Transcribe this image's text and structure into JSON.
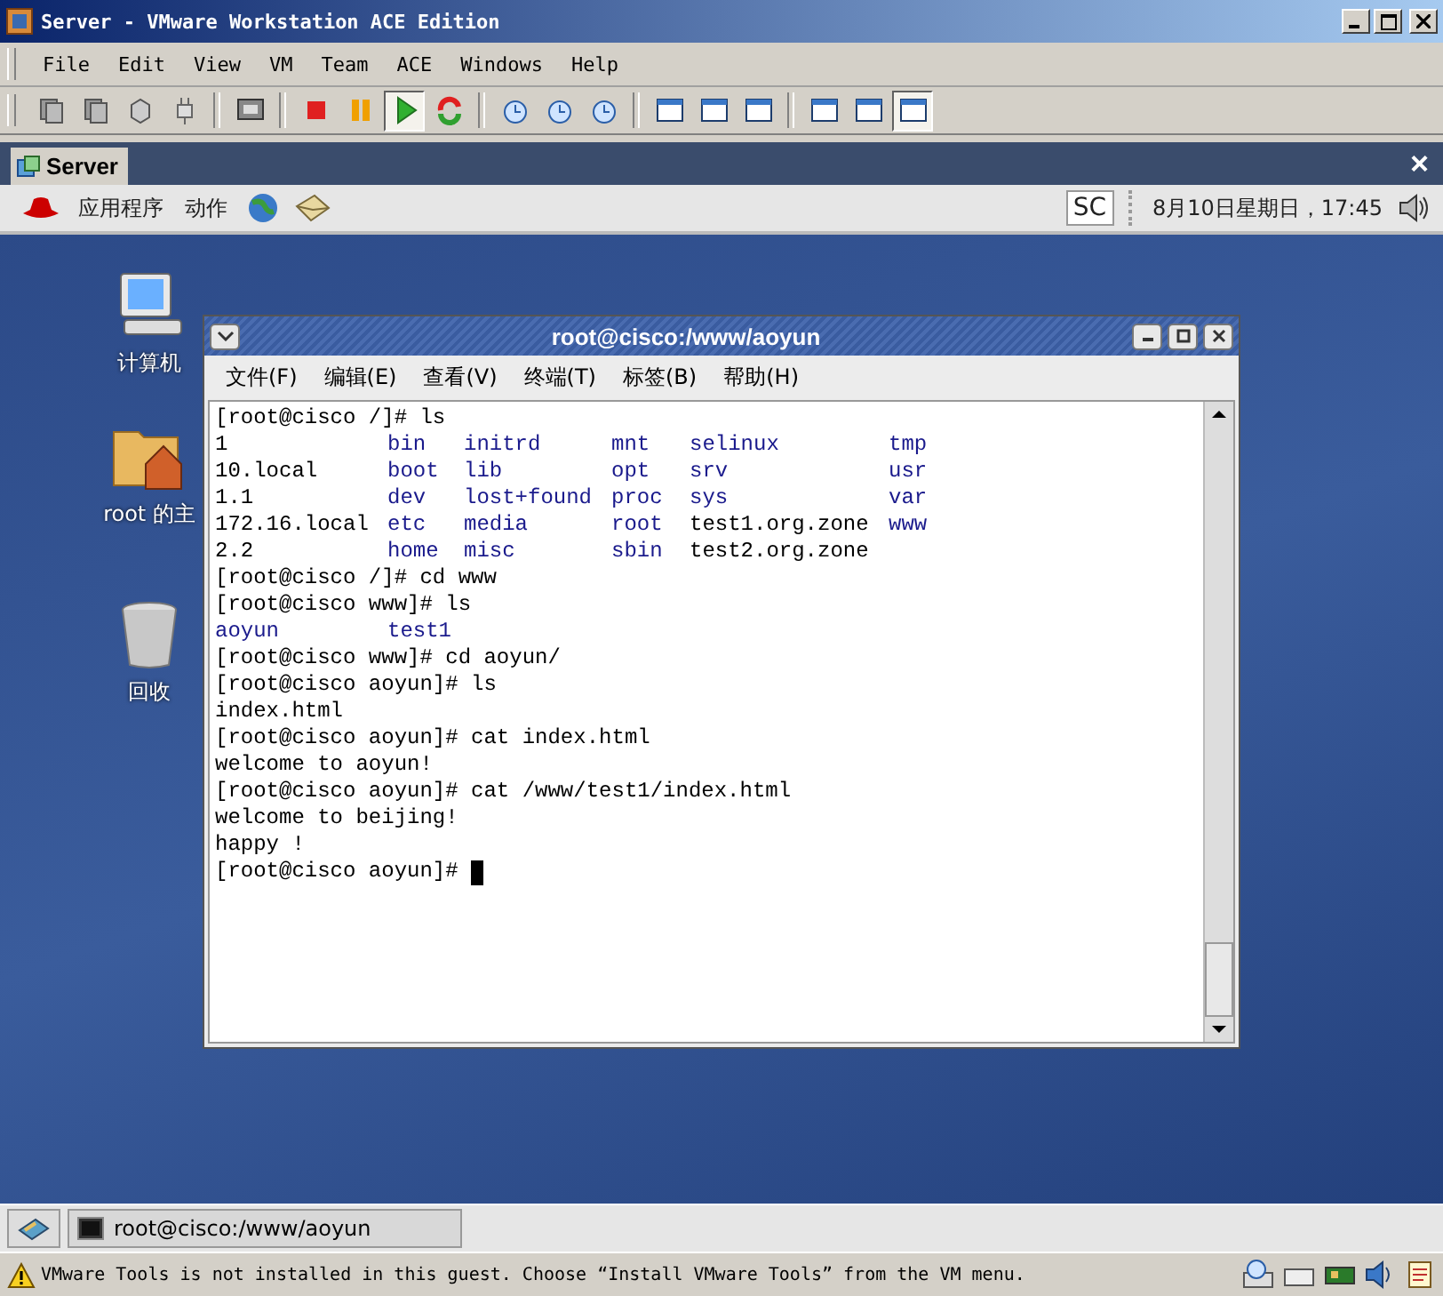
{
  "window": {
    "title": "Server - VMware Workstation ACE Edition"
  },
  "menu": [
    "File",
    "Edit",
    "View",
    "VM",
    "Team",
    "ACE",
    "Windows",
    "Help"
  ],
  "toolbar": [
    [
      {
        "kind": "snap",
        "pressed": false
      },
      {
        "kind": "snap",
        "pressed": false
      },
      {
        "kind": "cube",
        "pressed": false
      },
      {
        "kind": "plug",
        "pressed": false
      }
    ],
    [
      {
        "kind": "screen",
        "pressed": false
      }
    ],
    [
      {
        "kind": "stop",
        "pressed": false
      },
      {
        "kind": "pause",
        "pressed": false
      },
      {
        "kind": "play",
        "pressed": true
      },
      {
        "kind": "reset",
        "pressed": false
      }
    ],
    [
      {
        "kind": "clock",
        "pressed": false
      },
      {
        "kind": "clock",
        "pressed": false
      },
      {
        "kind": "clock",
        "pressed": false
      }
    ],
    [
      {
        "kind": "win",
        "pressed": false
      },
      {
        "kind": "win",
        "pressed": false
      },
      {
        "kind": "win",
        "pressed": false
      }
    ],
    [
      {
        "kind": "win",
        "pressed": false
      },
      {
        "kind": "win",
        "pressed": false
      },
      {
        "kind": "win",
        "pressed": true
      }
    ]
  ],
  "tabs": [
    {
      "label": "Server",
      "selected": true
    }
  ],
  "tab_close": "×",
  "panel": {
    "menus": [
      "应用程序",
      "动作"
    ],
    "input_method": "SC",
    "clock": "8月10日星期日，17:45"
  },
  "desktop_icons": [
    {
      "kind": "computer",
      "label": "计算机"
    },
    {
      "kind": "home",
      "label": "root 的主"
    },
    {
      "kind": "trash",
      "label": "回收"
    }
  ],
  "terminal": {
    "title": "root@cisco:/www/aoyun",
    "menu": [
      "文件(F)",
      "编辑(E)",
      "查看(V)",
      "终端(T)",
      "标签(B)",
      "帮助(H)"
    ],
    "lines": [
      {
        "kind": "text",
        "text": "[root@cisco /]# ls"
      },
      {
        "kind": "listing",
        "cells": [
          {
            "text": "1",
            "color": "#000000"
          },
          {
            "text": "bin",
            "color": "#1a1a8c"
          },
          {
            "text": "initrd",
            "color": "#1a1a8c"
          },
          {
            "text": "mnt",
            "color": "#1a1a8c"
          },
          {
            "text": "selinux",
            "color": "#1a1a8c"
          },
          {
            "text": "tmp",
            "color": "#1a1a8c"
          }
        ]
      },
      {
        "kind": "listing",
        "cells": [
          {
            "text": "10.local",
            "color": "#000000"
          },
          {
            "text": "boot",
            "color": "#1a1a8c"
          },
          {
            "text": "lib",
            "color": "#1a1a8c"
          },
          {
            "text": "opt",
            "color": "#1a1a8c"
          },
          {
            "text": "srv",
            "color": "#1a1a8c"
          },
          {
            "text": "usr",
            "color": "#1a1a8c"
          }
        ]
      },
      {
        "kind": "listing",
        "cells": [
          {
            "text": "1.1",
            "color": "#000000"
          },
          {
            "text": "dev",
            "color": "#1a1a8c"
          },
          {
            "text": "lost+found",
            "color": "#1a1a8c"
          },
          {
            "text": "proc",
            "color": "#1a1a8c"
          },
          {
            "text": "sys",
            "color": "#1a1a8c"
          },
          {
            "text": "var",
            "color": "#1a1a8c"
          }
        ]
      },
      {
        "kind": "listing",
        "cells": [
          {
            "text": "172.16.local",
            "color": "#000000"
          },
          {
            "text": "etc",
            "color": "#1a1a8c"
          },
          {
            "text": "media",
            "color": "#1a1a8c"
          },
          {
            "text": "root",
            "color": "#1a1a8c"
          },
          {
            "text": "test1.org.zone",
            "color": "#000000"
          },
          {
            "text": "www",
            "color": "#1a1a8c"
          }
        ]
      },
      {
        "kind": "listing",
        "cells": [
          {
            "text": "2.2",
            "color": "#000000"
          },
          {
            "text": "home",
            "color": "#1a1a8c"
          },
          {
            "text": "misc",
            "color": "#1a1a8c"
          },
          {
            "text": "sbin",
            "color": "#1a1a8c"
          },
          {
            "text": "test2.org.zone",
            "color": "#000000"
          }
        ]
      },
      {
        "kind": "text",
        "text": "[root@cisco /]# cd www"
      },
      {
        "kind": "text",
        "text": "[root@cisco www]# ls"
      },
      {
        "kind": "listing",
        "cells": [
          {
            "text": "aoyun",
            "color": "#1a1a8c"
          },
          {
            "text": "test1",
            "color": "#1a1a8c"
          }
        ]
      },
      {
        "kind": "text",
        "text": "[root@cisco www]# cd aoyun/"
      },
      {
        "kind": "text",
        "text": "[root@cisco aoyun]# ls"
      },
      {
        "kind": "text",
        "text": "index.html"
      },
      {
        "kind": "text",
        "text": "[root@cisco aoyun]# cat index.html"
      },
      {
        "kind": "text",
        "text": "welcome to aoyun!"
      },
      {
        "kind": "text",
        "text": "[root@cisco aoyun]# cat /www/test1/index.html"
      },
      {
        "kind": "text",
        "text": "welcome to beijing!"
      },
      {
        "kind": "text",
        "text": "happy !"
      },
      {
        "kind": "prompt",
        "text": "[root@cisco aoyun]#"
      }
    ]
  },
  "taskbar": [
    {
      "label": "root@cisco:/www/aoyun",
      "selected": false
    }
  ],
  "status": {
    "message": "VMware Tools is not installed in this guest. Choose “Install VMware Tools” from the VM menu."
  }
}
